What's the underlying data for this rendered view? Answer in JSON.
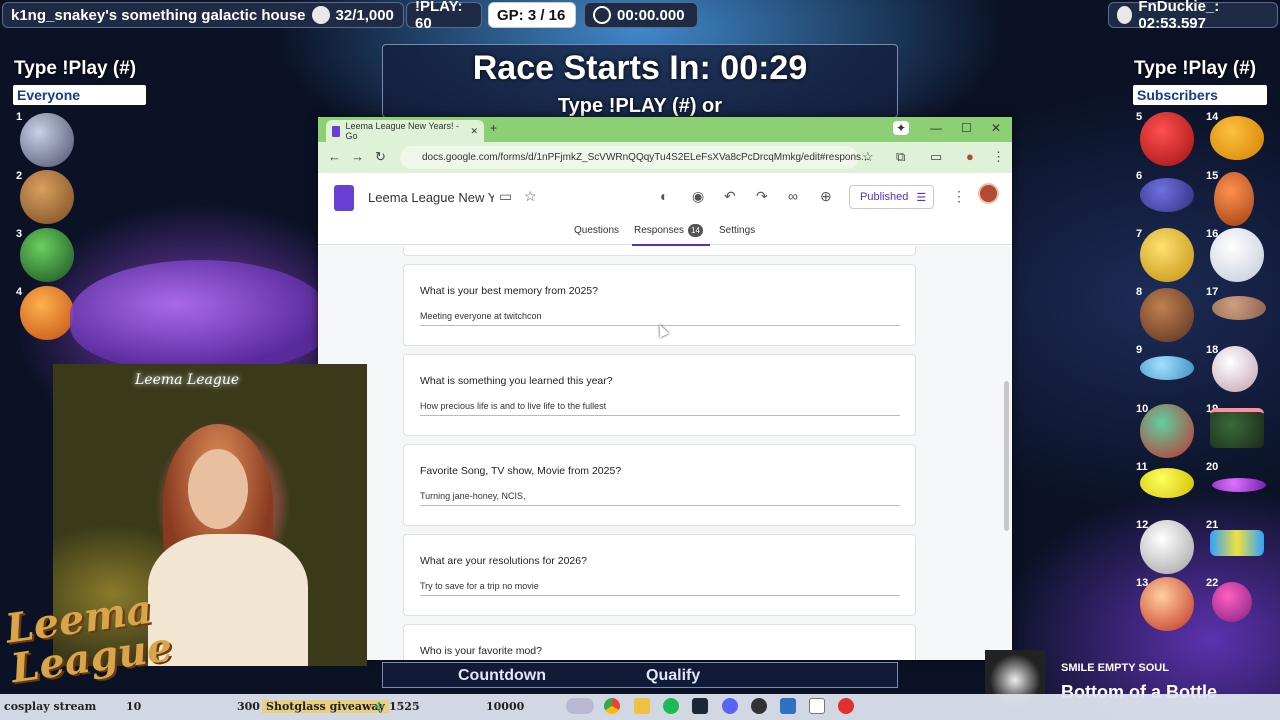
{
  "top_bar": {
    "house_label": "k1ng_snakey's something galactic house",
    "count": "32/1,000",
    "play_count": "!PLAY: 60",
    "gp": "GP: 3 / 16",
    "timer": "00:00.000",
    "duckie": "FnDuckie_: 02:53.597"
  },
  "left_panel": {
    "title": "Type !Play (#)",
    "group": "Everyone",
    "slots": [
      "1",
      "2",
      "3",
      "4"
    ]
  },
  "right_panel": {
    "title": "Type !Play (#)",
    "group": "Subscribers",
    "slots": [
      "5",
      "6",
      "7",
      "8",
      "9",
      "10",
      "11",
      "12",
      "13",
      "14",
      "15",
      "16",
      "17",
      "18",
      "19",
      "20",
      "21",
      "22"
    ]
  },
  "race": {
    "title": "Race Starts In: 00:29",
    "sub": "Type !PLAY (#) or"
  },
  "browser": {
    "tab_title": "Leema League New Years! - Go",
    "url": "docs.google.com/forms/d/1nPFjmkZ_ScVWRnQQqyTu4S2ELeFsXVa8cPcDrcqMmkg/edit#respons...",
    "doc_title": "Leema League New Yea",
    "published_label": "Published",
    "tabs": {
      "questions": "Questions",
      "responses": "Responses",
      "settings": "Settings"
    },
    "responses_count": "14",
    "cards": [
      {
        "question": "What is your best memory from 2025?",
        "answer": "Meeting everyone at twitchcon"
      },
      {
        "question": "What is something you learned this year?",
        "answer": "How precious  life is and to live life to the fullest"
      },
      {
        "question": "Favorite Song, TV show, Movie from 2025?",
        "answer": "Turning jane-honey, NCIS,"
      },
      {
        "question": "What are your resolutions for 2026?",
        "answer": "Try to save for a trip no movie"
      },
      {
        "question": "Who is your favorite mod?",
        "answer": ""
      }
    ]
  },
  "lower_panel": {
    "countdown": "Countdown",
    "qualify": "Qualify"
  },
  "bottom_bar": {
    "left_text": "cosplay stream",
    "n1": "10",
    "n2": "300",
    "giveaway": "Shotglass giveaway",
    "n3": "1525",
    "n4": "10000"
  },
  "music": {
    "artist": "SMILE EMPTY SOUL",
    "song": "Bottom of a Bottle"
  },
  "logo_text": "Leema League"
}
